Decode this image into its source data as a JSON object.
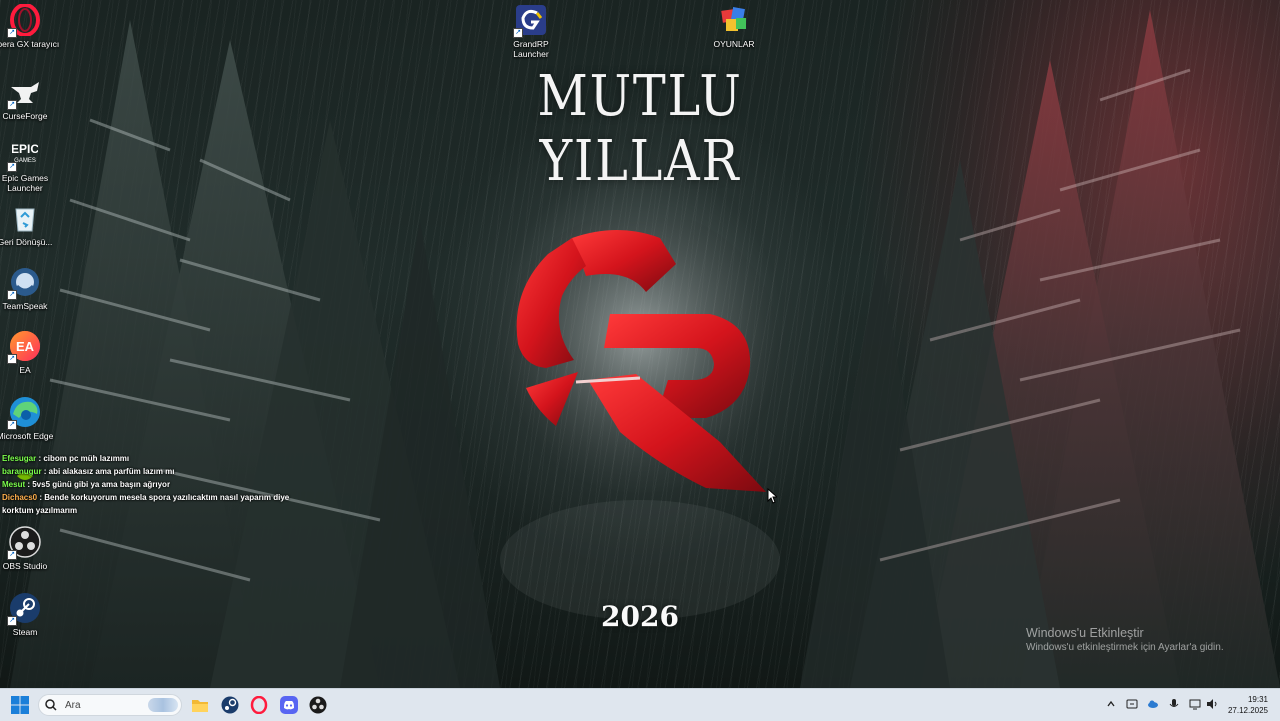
{
  "desktop_icons": [
    {
      "label": "Opera GX tarayıcı",
      "icon": "opera-gx-icon"
    },
    {
      "label": "CurseForge",
      "icon": "curseforge-icon"
    },
    {
      "label": "Epic Games Launcher",
      "icon": "epic-games-icon"
    },
    {
      "label": "Geri Dönüşü...",
      "icon": "recycle-bin-icon"
    },
    {
      "label": "TeamSpeak",
      "icon": "teamspeak-icon"
    },
    {
      "label": "EA",
      "icon": "ea-icon"
    },
    {
      "label": "Microsoft Edge",
      "icon": "edge-icon"
    },
    {
      "label": "OBS Studio",
      "icon": "obs-icon"
    },
    {
      "label": "Steam",
      "icon": "steam-icon"
    },
    {
      "label": "GrandRP Launcher",
      "icon": "grandrp-icon"
    },
    {
      "label": "OYUNLAR",
      "icon": "folder-games-icon"
    }
  ],
  "wallpaper": {
    "headline": "MUTLU YILLAR",
    "year": "2026",
    "logo": "grandrp-logo",
    "accent_color": "#d4141c"
  },
  "chat": [
    {
      "user": "Efesugar",
      "message": " : cibom pc müh lazımmı"
    },
    {
      "user": "baranugur",
      "message": " : abi alakasız ama parfüm lazım mı"
    },
    {
      "user": "Mesut",
      "message": " : 5vs5 günü gibi ya ama başın ağrıyor"
    },
    {
      "user": "Dichacs0",
      "message": " : Bende korkuyorum mesela spora yazılıcaktım nasıl yaparım diye korktum yazılmarım"
    }
  ],
  "activation": {
    "title": "Windows'u Etkinleştir",
    "subtitle": "Windows'u etkinleştirmek için Ayarlar'a gidin."
  },
  "taskbar": {
    "search_placeholder": "Ara",
    "pinned": [
      "file-explorer-icon",
      "steam-icon",
      "opera-gx-icon",
      "discord-icon",
      "obs-icon"
    ],
    "time": "19:31",
    "date": "27.12.2025"
  }
}
